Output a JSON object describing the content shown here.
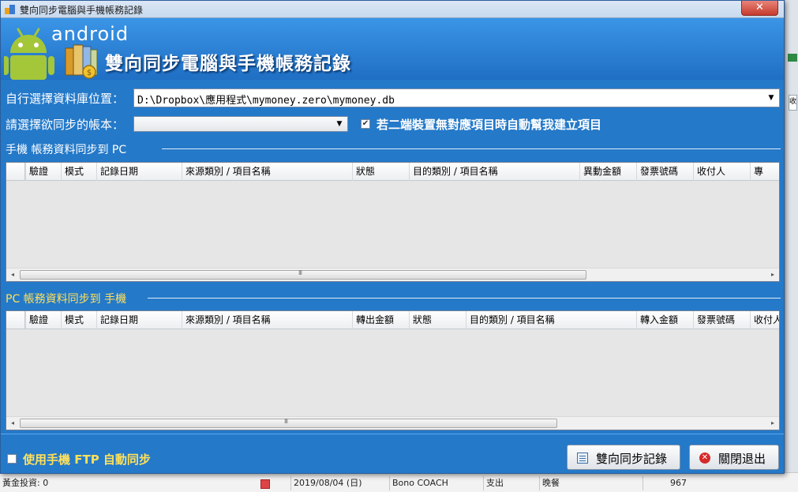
{
  "window": {
    "title": "雙向同步電腦與手機帳務記錄",
    "close_glyph": "✕"
  },
  "banner": {
    "logo_text": "android",
    "title": "雙向同步電腦與手機帳務記錄"
  },
  "form": {
    "db_label": "自行選擇資料庫位置：",
    "db_path": "D:\\Dropbox\\應用程式\\mymoney.zero\\mymoney.db",
    "account_label": "請選擇欲同步的帳本：",
    "account_value": "",
    "auto_create_checked": true,
    "auto_create_label": "若二端裝置無對應項目時自動幫我建立項目"
  },
  "section_phone_to_pc": {
    "title": "手機 帳務資料同步到 PC",
    "columns": [
      "驗證",
      "模式",
      "記錄日期",
      "來源類別 / 項目名稱",
      "狀態",
      "目的類別 / 項目名稱",
      "異動金額",
      "發票號碼",
      "收付人",
      "專"
    ]
  },
  "section_pc_to_phone": {
    "title": "PC 帳務資料同步到 手機",
    "columns": [
      "驗證",
      "模式",
      "記錄日期",
      "來源類別 / 項目名稱",
      "轉出金額",
      "狀態",
      "目的類別 / 項目名稱",
      "轉入金額",
      "發票號碼",
      "收付人"
    ]
  },
  "scrollbar": {
    "grip": "III",
    "left_arrow": "◂",
    "right_arrow": "▸"
  },
  "footer": {
    "ftp_checked": false,
    "ftp_label": "使用手機 FTP 自動同步",
    "sync_button": "雙向同步記錄",
    "exit_button": "關閉退出"
  },
  "background": {
    "right_tab": "收",
    "bottom_row": [
      "黃金投資: 0",
      "2019/08/04 (日)",
      "Bono COACH",
      "支出",
      "晚餐",
      "967"
    ]
  },
  "colors": {
    "window_blue": "#2479c9",
    "section_yellow": "#ffe05a",
    "close_red": "#c63b2c"
  }
}
